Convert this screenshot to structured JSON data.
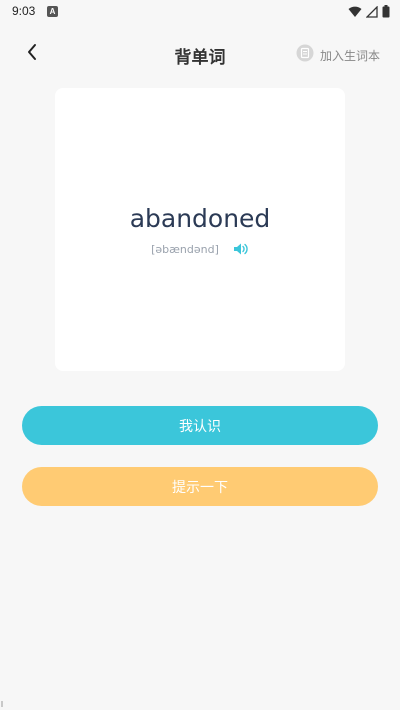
{
  "status_bar": {
    "time": "9:03",
    "notification_badge": "A",
    "icons": [
      "wifi-icon",
      "signal-icon",
      "battery-icon"
    ]
  },
  "header": {
    "title": "背单词",
    "back_icon": "chevron-left-icon",
    "add_to_vocab_label": "加入生词本",
    "add_to_vocab_icon": "notebook-icon"
  },
  "card": {
    "word": "abandoned",
    "phonetic": "[əbændənd]",
    "speaker_icon": "speaker-icon"
  },
  "buttons": {
    "know_label": "我认识",
    "hint_label": "提示一下"
  },
  "colors": {
    "primary": "#3bc6da",
    "hint": "#ffcb73",
    "background": "#f7f7f7",
    "word": "#2b3a55"
  }
}
